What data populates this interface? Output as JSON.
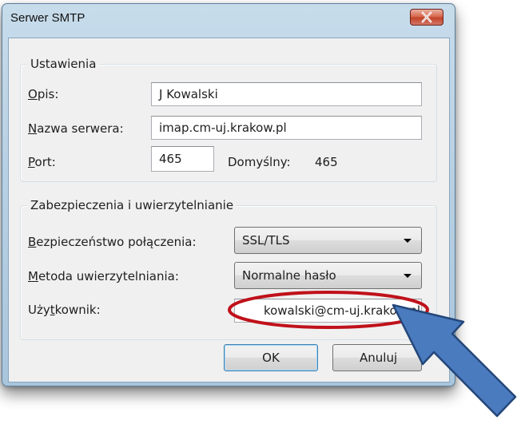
{
  "window": {
    "title": "Serwer SMTP",
    "close_icon": "close-x-icon"
  },
  "settings": {
    "legend": "Ustawienia",
    "description": {
      "label_u": "O",
      "label_rest": "pis:",
      "value": "J Kowalski"
    },
    "server_name": {
      "label_u": "N",
      "label_rest": "azwa serwera:",
      "value": "imap.cm-uj.krakow.pl"
    },
    "port": {
      "label_u": "P",
      "label_rest": "ort:",
      "value": "465",
      "default_label": "Domyślny:",
      "default_value": "465"
    }
  },
  "security": {
    "legend": "Zabezpieczenia i uwierzytelnianie",
    "connection": {
      "label_u": "B",
      "label_rest": "ezpieczeństwo połączenia:",
      "value": "SSL/TLS"
    },
    "auth_method": {
      "label_u": "M",
      "label_rest": "etoda uwierzytelniania:",
      "value": "Normalne hasło"
    },
    "username": {
      "label_pre": "Uży",
      "label_u": "t",
      "label_rest": "kownik:",
      "value": "kowalski@cm-uj.krakow.pl"
    }
  },
  "buttons": {
    "ok": "OK",
    "cancel": "Anuluj"
  },
  "annotations": {
    "ellipse_color": "#c0111a",
    "arrow_color": "#4a7bbf",
    "arrow_border": "#24477a"
  }
}
